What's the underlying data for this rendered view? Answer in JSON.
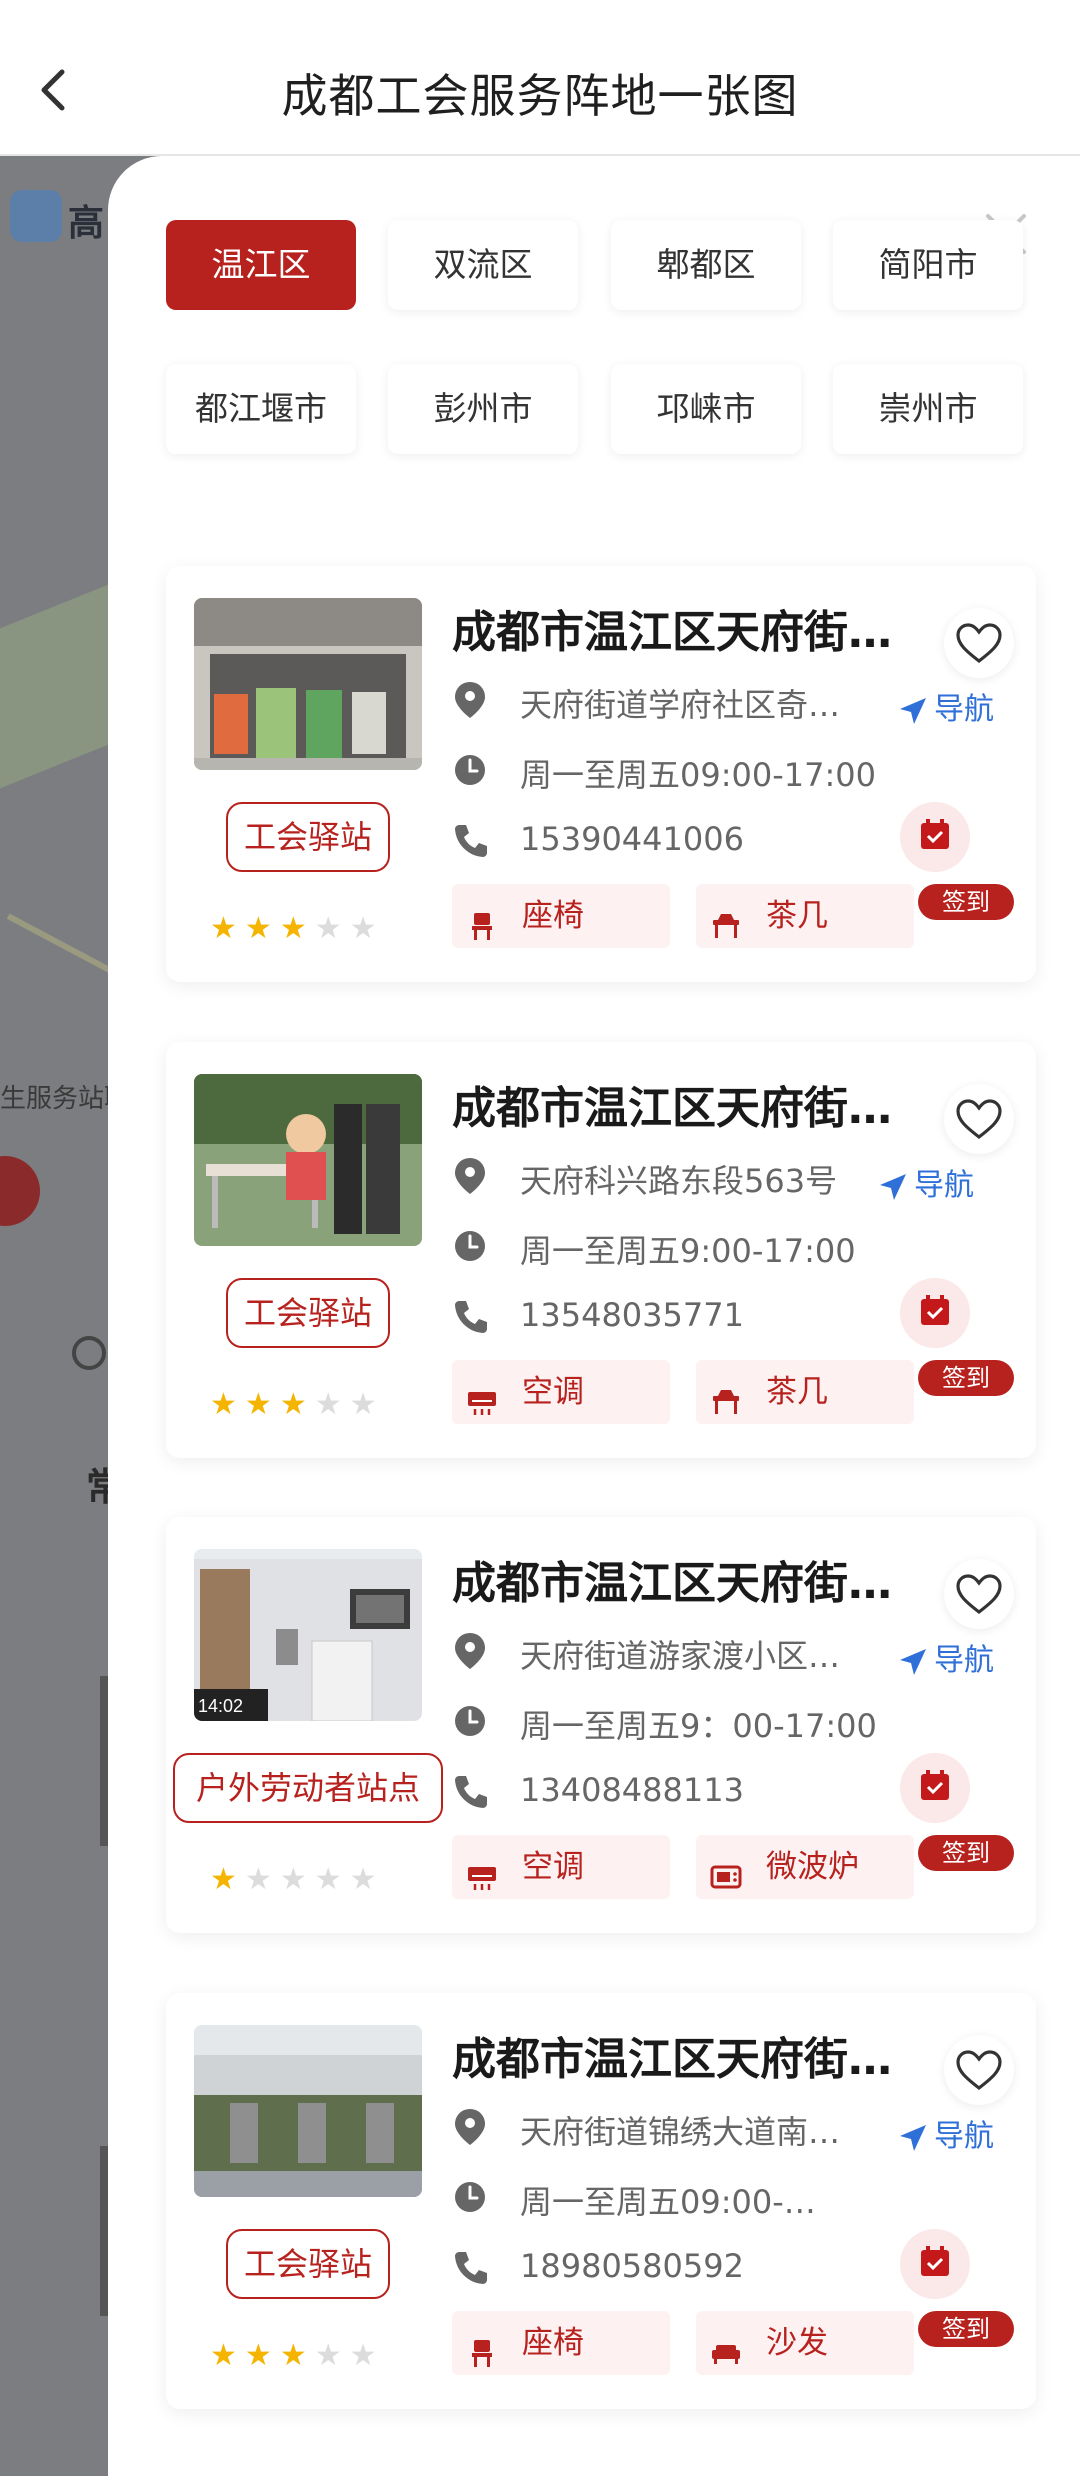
{
  "header": {
    "title": "成都工会服务阵地一张图"
  },
  "background": {
    "app_logo_text": "高",
    "strip_text": "生服务站职",
    "side_text": "常"
  },
  "filters": [
    "温江区",
    "双流区",
    "郫都区",
    "简阳市",
    "都江堰市",
    "彭州市",
    "邛崃市",
    "崇州市"
  ],
  "active_filter": "温江区",
  "cards": [
    {
      "title": "成都市温江区天府街道学府社区奇…",
      "address": "天府街道学府社区奇…",
      "nav_label": "导航",
      "hours": "周一至周五09:00-17:00",
      "phone": "15390441006",
      "type_badge": "工会驿站",
      "rating": 3,
      "tags": [
        {
          "icon": "chair-icon",
          "label": "座椅"
        },
        {
          "icon": "tea-table-icon",
          "label": "茶几"
        }
      ],
      "checkin_label": "签到"
    },
    {
      "title": "成都市温江区天府街道服务站…",
      "address": "天府科兴路东段563号",
      "nav_label": "导航",
      "hours": "周一至周五9:00-17:00",
      "phone": "13548035771",
      "type_badge": "工会驿站",
      "rating": 3,
      "tags": [
        {
          "icon": "air-conditioner-icon",
          "label": "空调"
        },
        {
          "icon": "tea-table-icon",
          "label": "茶几"
        }
      ],
      "checkin_label": "签到"
    },
    {
      "title": "成都市温江区天府街道游家渡…",
      "address": "天府街道游家渡小区…",
      "nav_label": "导航",
      "hours": "周一至周五9：00-17:00",
      "phone": "13408488113",
      "type_badge": "户外劳动者站点",
      "rating": 1,
      "tags": [
        {
          "icon": "air-conditioner-icon",
          "label": "空调"
        },
        {
          "icon": "microwave-icon",
          "label": "微波炉"
        }
      ],
      "checkin_label": "签到"
    },
    {
      "title": "成都市温江区天府街道锦绣…",
      "address": "天府街道锦绣大道南…",
      "nav_label": "导航",
      "hours": "周一至周五09:00-…",
      "phone": "18980580592",
      "type_badge": "工会驿站",
      "rating": 3,
      "tags": [
        {
          "icon": "chair-icon",
          "label": "座椅"
        },
        {
          "icon": "sofa-icon",
          "label": "沙发"
        }
      ],
      "checkin_label": "签到"
    }
  ],
  "colors": {
    "accent": "#b8221e",
    "nav_blue": "#2f6fd8",
    "star": "#f5b400"
  }
}
